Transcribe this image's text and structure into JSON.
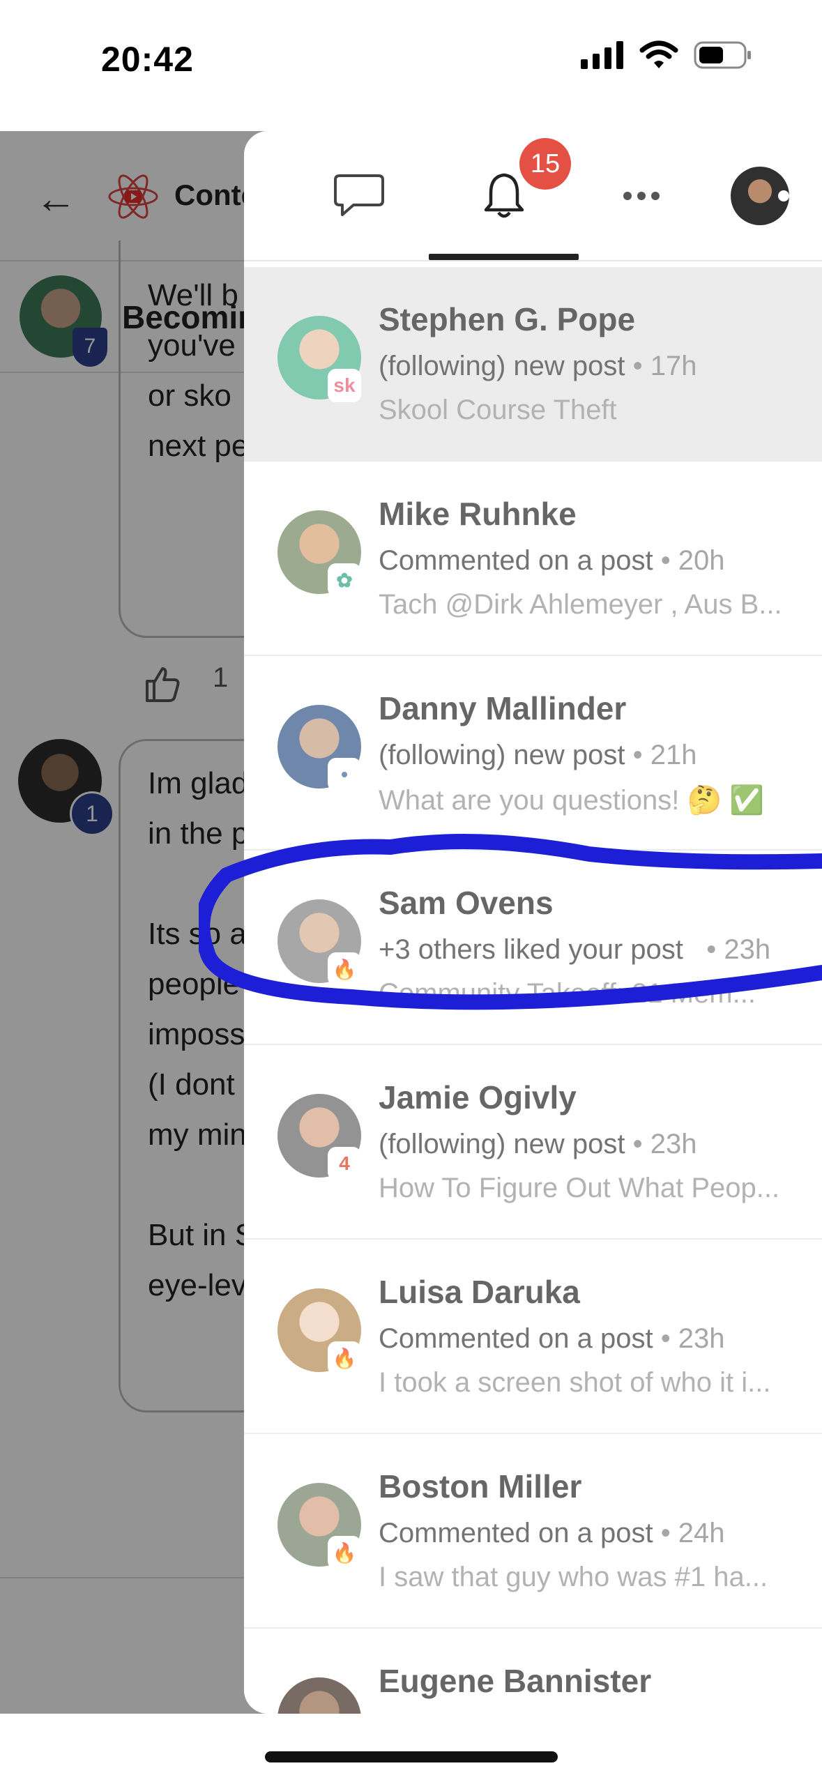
{
  "status_bar": {
    "time": "20:42"
  },
  "background_post": {
    "header_title": "Conte",
    "author_title": "Becomin",
    "author_level": "7",
    "comment1_lines": [
      "We'll b",
      "you've",
      "or sko",
      "next pe"
    ],
    "like_count": "1",
    "commenter_level": "1",
    "comment2_lines": [
      "Im glad",
      "in the p",
      "",
      "Its so a",
      "people",
      "imposs",
      "(I dont",
      "my min",
      "",
      "But in S",
      "eye-lev"
    ]
  },
  "panel": {
    "tabs": {
      "chat_icon": "chat-bubble-icon",
      "bell_icon": "bell-icon",
      "more_icon": "more-dots-icon",
      "badge_count": "15"
    },
    "notifications": [
      {
        "name": "Stephen G. Pope",
        "action": "(following) new post",
        "time": "• 17h",
        "preview": "Skool Course Theft",
        "badge": "sk",
        "badge_color": "#e8677a",
        "avatar_colors": [
          "#e8c4a8",
          "#59b894"
        ],
        "highlight": true
      },
      {
        "name": "Mike Ruhnke",
        "action": "Commented on a post",
        "time": "• 20h",
        "preview": "Tach @Dirk Ahlemeyer , Aus B...",
        "badge": "✿",
        "badge_color": "#3da98b",
        "avatar_colors": [
          "#d9a87f",
          "#7b8f6a"
        ],
        "highlight": false
      },
      {
        "name": "Danny Mallinder",
        "action": "(following) new post",
        "time": "• 21h",
        "preview": "What are you questions! 🤔 ✅",
        "badge": "•",
        "badge_color": "#4a6fa5",
        "avatar_colors": [
          "#c9a48a",
          "#3f5f8f"
        ],
        "highlight": false
      },
      {
        "name": "Sam Ovens",
        "action": "+3 others liked your post",
        "time": "  • 23h",
        "preview": "Community Takeoff: 21 Mem...",
        "badge": "🔥",
        "badge_color": "#e07a2e",
        "avatar_colors": [
          "#d9b49a",
          "#8a8a8a"
        ],
        "highlight": false
      },
      {
        "name": "Jamie Ogivly",
        "action": "(following) new post",
        "time": "• 23h",
        "preview": "How To Figure Out What Peop...",
        "badge": "4",
        "badge_color": "#e04a2a",
        "avatar_colors": [
          "#d7a98b",
          "#6f6f6f"
        ],
        "highlight": false
      },
      {
        "name": "Luisa Daruka",
        "action": "Commented on a post",
        "time": "• 23h",
        "preview": "I took a screen shot of who it i...",
        "badge": "🔥",
        "badge_color": "#e07a2e",
        "avatar_colors": [
          "#f1d3bd",
          "#b8925c"
        ],
        "highlight": false
      },
      {
        "name": "Boston Miller",
        "action": "Commented on a post",
        "time": "• 24h",
        "preview": "I saw that guy who was #1 ha...",
        "badge": "🔥",
        "badge_color": "#e07a2e",
        "avatar_colors": [
          "#d8a98c",
          "#7a8a70"
        ],
        "highlight": false
      },
      {
        "name": "Eugene Bannister",
        "action": "",
        "time": "",
        "preview": "",
        "badge": "",
        "badge_color": "#ffffff",
        "avatar_colors": [
          "#9a7258",
          "#4a3a30"
        ],
        "highlight": false
      }
    ]
  },
  "annotation": {
    "color": "#1d1fd6"
  }
}
